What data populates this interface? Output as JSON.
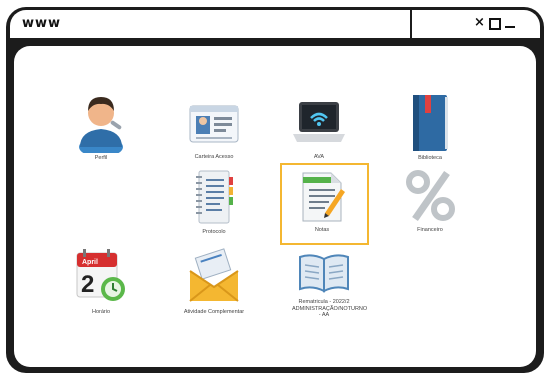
{
  "window": {
    "url_text": "www",
    "controls": {
      "close_icon": "close-icon",
      "maximize_icon": "maximize-icon",
      "minimize_icon": "minimize-icon"
    }
  },
  "apps": [
    {
      "label": "Perfil",
      "icon": "user-profile-icon"
    },
    {
      "label": "Carteira Acesso",
      "icon": "id-card-icon"
    },
    {
      "label": "AVA",
      "icon": "laptop-wifi-icon"
    },
    {
      "label": "Biblioteca",
      "icon": "book-icon"
    },
    {
      "label": "Protocolo",
      "icon": "notebook-icon"
    },
    {
      "label": "Notas",
      "icon": "notes-pencil-icon",
      "selected": true
    },
    {
      "label": "Financeiro",
      "icon": "percent-icon"
    },
    {
      "label": "Horário",
      "icon": "calendar-clock-icon",
      "calendar_month": "April",
      "calendar_day": "2"
    },
    {
      "label": "Atividade Complementar",
      "icon": "envelope-icon"
    },
    {
      "label": "Rematricula - 2022/2 ADMINISTRAÇÃO/NOTURNO - AA",
      "icon": "open-book-icon"
    }
  ],
  "colors": {
    "frame": "#1c1c1c",
    "selection": "#f4b731",
    "background": "#ffffff"
  }
}
